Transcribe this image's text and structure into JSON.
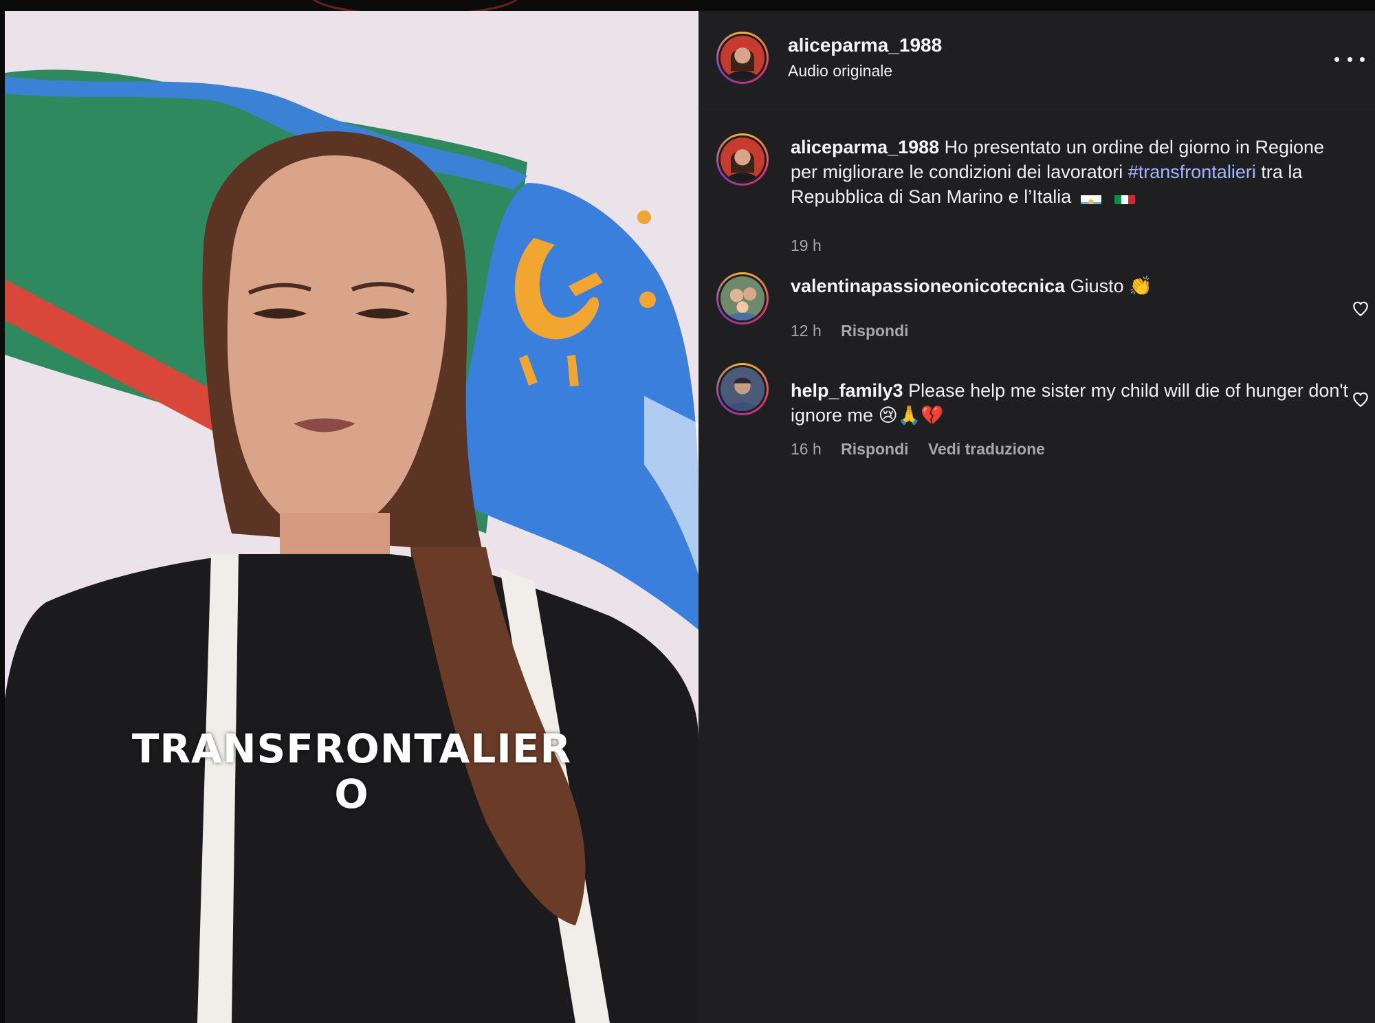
{
  "post": {
    "username": "aliceparma_1988",
    "audio_label": "Audio originale",
    "video_caption_line1": "TRANSFRONTALIER",
    "video_caption_line2": "O"
  },
  "caption": {
    "username": "aliceparma_1988",
    "text_before": " Ho presentato un ordine del giorno in Regione per migliorare le condizioni dei lavoratori ",
    "hashtag": "#transfrontalieri",
    "text_after": " tra la Repubblica di San Marino e l’Italia",
    "time": "19 h"
  },
  "comments": [
    {
      "username": "valentinapassioneonicotecnica",
      "text": " Giusto ",
      "emoji": "👏",
      "time": "12 h",
      "reply_label": "Rispondi"
    },
    {
      "username": "help_family3",
      "text": " Please help me sister my child will die of hunger don't ignore me ",
      "emoji": "😢🙏💔",
      "time": "16 h",
      "reply_label": "Rispondi",
      "translate_label": "Vedi traduzione"
    }
  ],
  "colors": {
    "panel_bg": "#1f1f22",
    "hashtag": "#a5b4ff",
    "meta_text": "#a8a8a8"
  }
}
